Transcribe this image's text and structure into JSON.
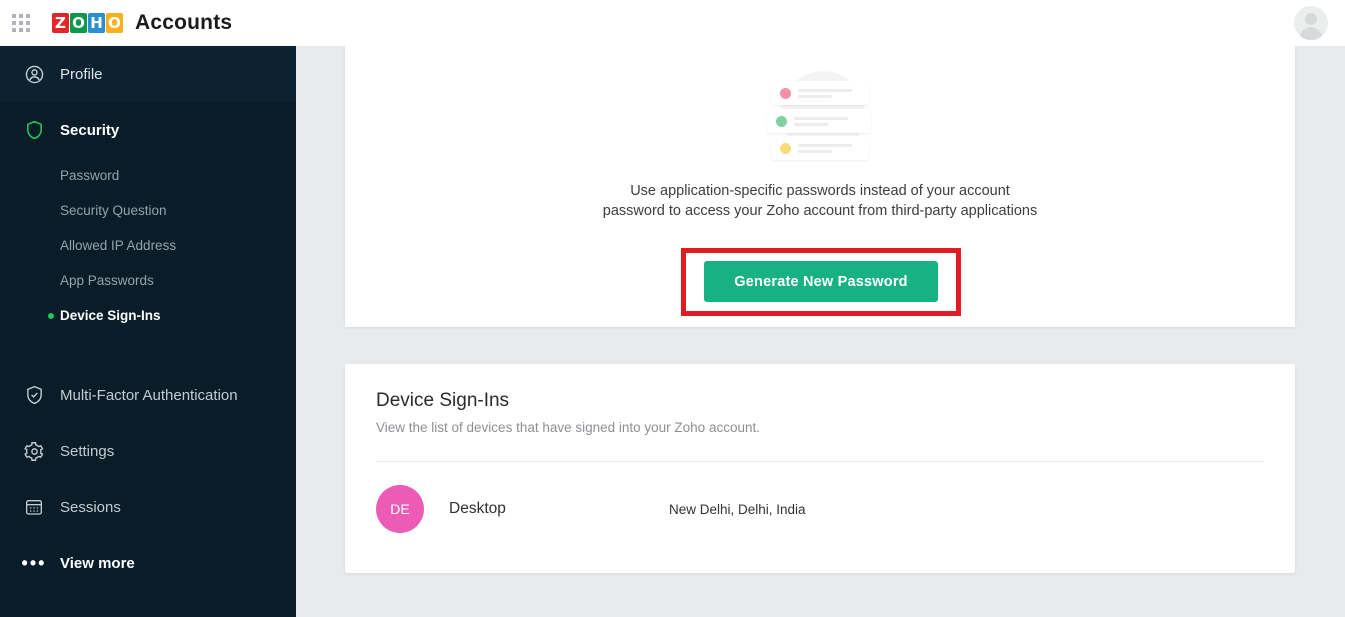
{
  "topbar": {
    "apps_icon": "apps-grid-icon",
    "logo_letters": [
      "Z",
      "O",
      "H",
      "O"
    ],
    "app_title": "Accounts",
    "avatar_icon": "user-avatar-icon"
  },
  "sidebar": {
    "profile": {
      "label": "Profile",
      "icon": "user-circle-icon"
    },
    "security": {
      "label": "Security",
      "icon": "shield-icon",
      "icon_color": "#21c45a"
    },
    "security_sub": [
      {
        "label": "Password",
        "active": false
      },
      {
        "label": "Security Question",
        "active": false
      },
      {
        "label": "Allowed IP Address",
        "active": false
      },
      {
        "label": "App Passwords",
        "active": false
      },
      {
        "label": "Device Sign-Ins",
        "active": true
      }
    ],
    "mfa": {
      "label": "Multi-Factor Authentication",
      "icon": "shield-check-icon"
    },
    "settings": {
      "label": "Settings",
      "icon": "gear-icon"
    },
    "sessions": {
      "label": "Sessions",
      "icon": "calendar-grid-icon"
    },
    "view_more": {
      "label": "View more",
      "icon": "ellipsis-icon"
    }
  },
  "app_passwords_card": {
    "illustration": {
      "name": "app-passwords-illustration",
      "dot_colors": [
        "#f490a8",
        "#7ed3a0",
        "#f5dd7a"
      ]
    },
    "description": "Use application-specific passwords instead of your account password to access your Zoho account from third-party applications",
    "generate_button_label": "Generate New Password",
    "generate_button_color": "#18b183",
    "highlight_color": "#e01b22"
  },
  "device_signins_card": {
    "title": "Device Sign-Ins",
    "subtitle": "View the list of devices that have signed into your Zoho account.",
    "rows": [
      {
        "initials": "DE",
        "avatar_color": "#ec5bb5",
        "device": "Desktop",
        "location": "New Delhi, Delhi, India"
      }
    ]
  }
}
